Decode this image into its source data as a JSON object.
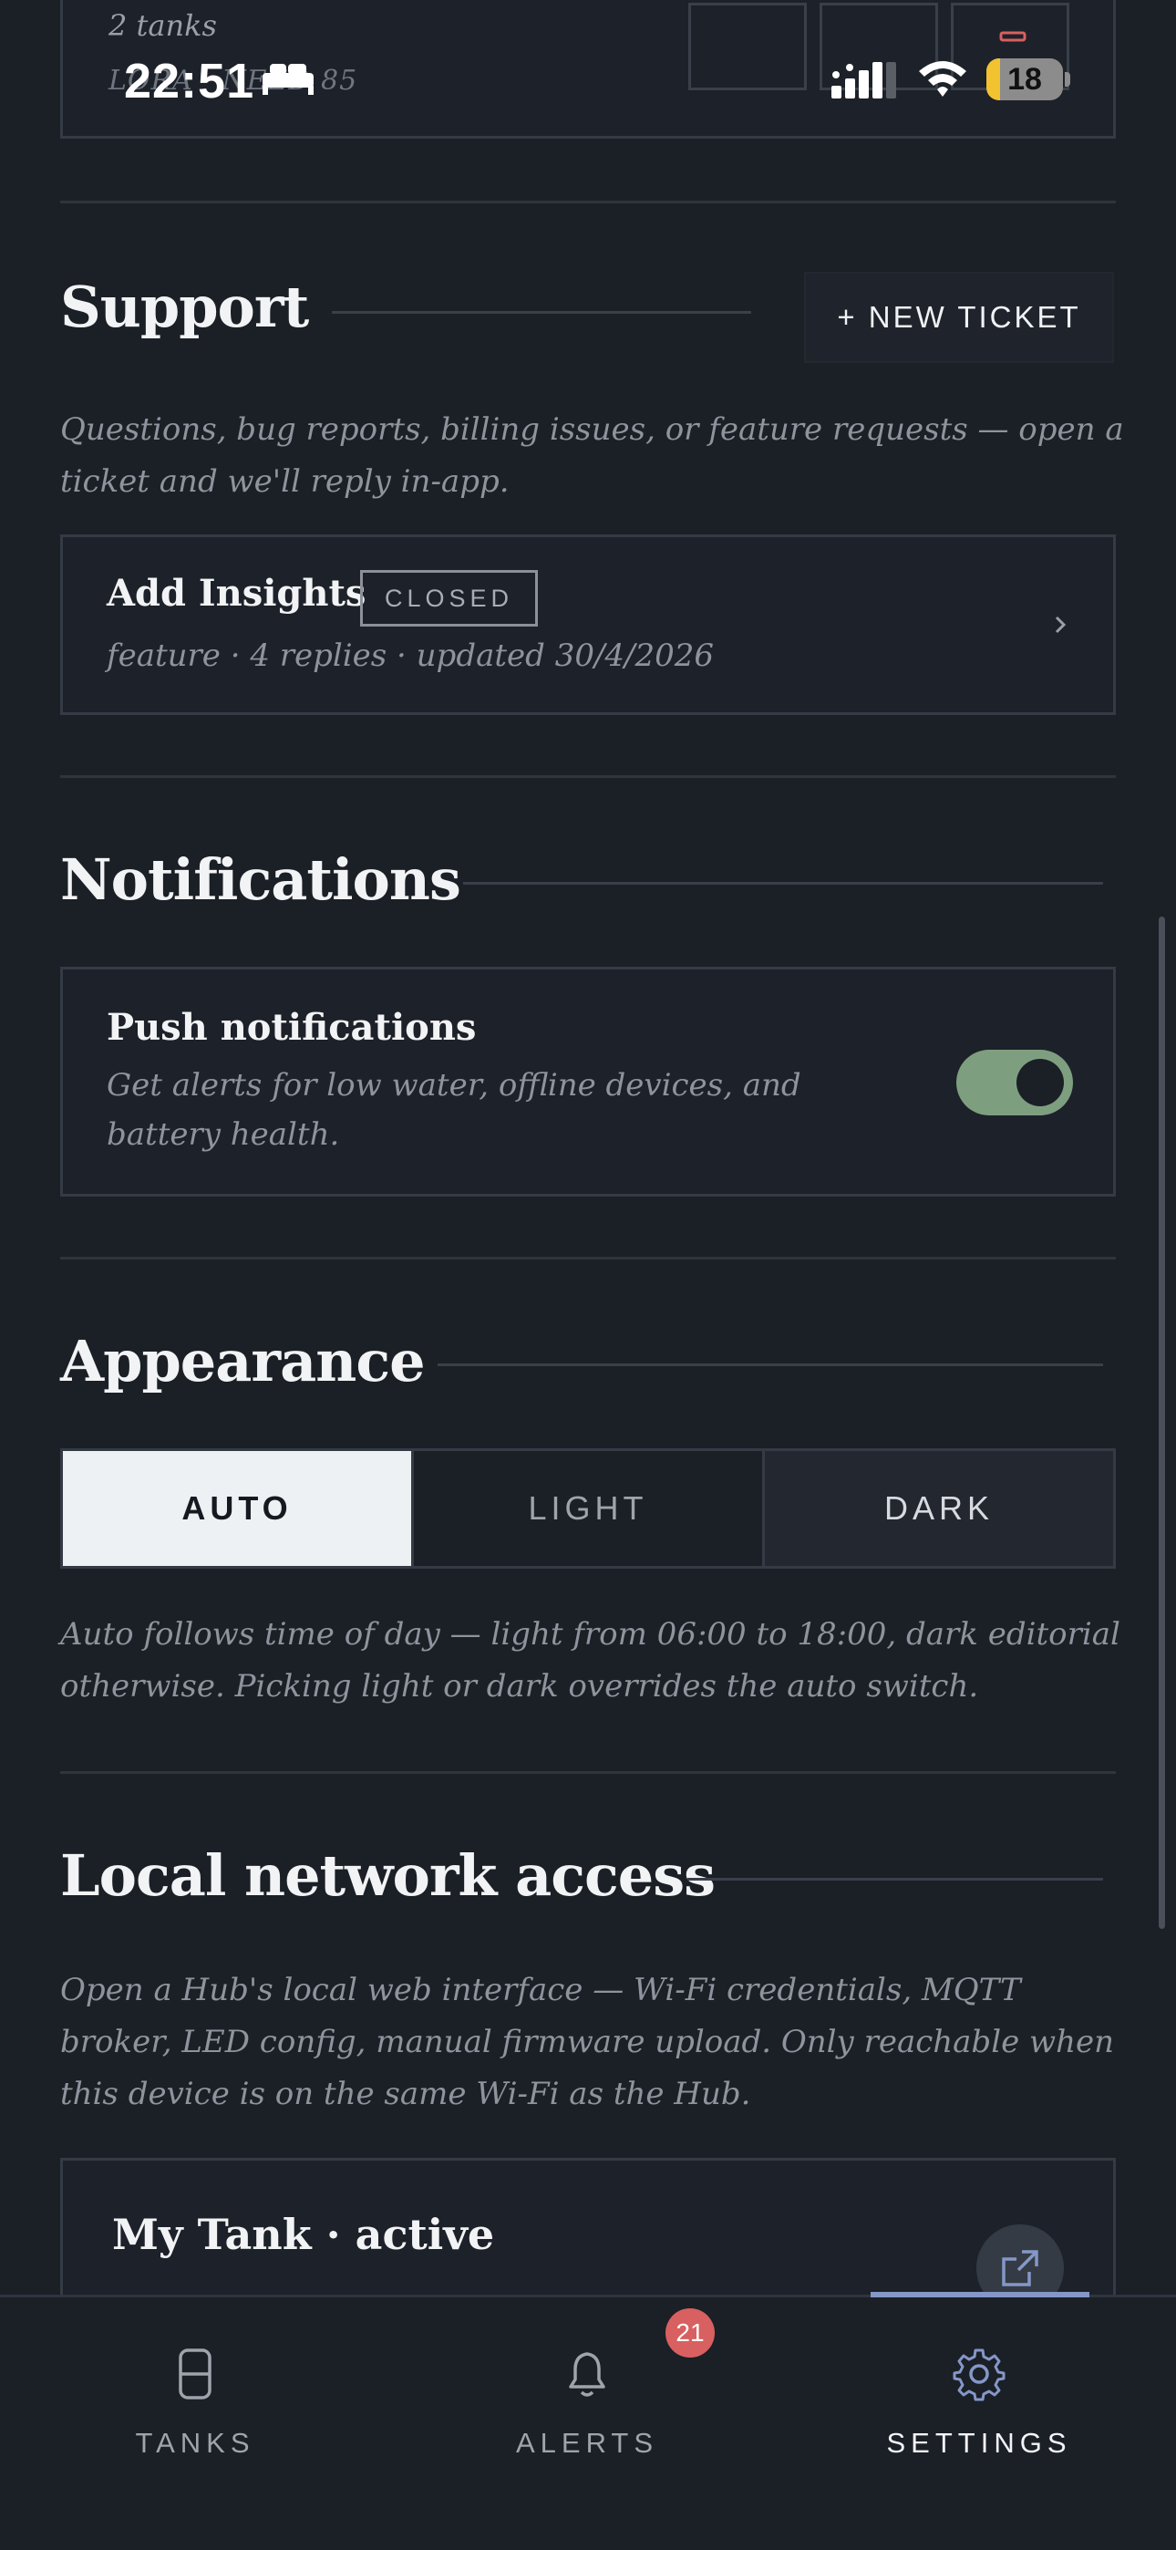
{
  "status_bar": {
    "time": "22:51",
    "battery_level": "18",
    "battery_fraction": 0.18
  },
  "tank_summary": {
    "count_text": "2 tanks",
    "leds_text": "LORA · NEED  85"
  },
  "support": {
    "title": "Support",
    "new_ticket_label": "+ NEW TICKET",
    "description": "Questions, bug reports, billing issues, or feature requests — open a ticket and we'll reply in-app.",
    "tickets": [
      {
        "title": "Add Insights",
        "status": "CLOSED",
        "meta": "feature · 4 replies · updated 30/4/2026"
      }
    ]
  },
  "notifications": {
    "title": "Notifications",
    "push_title": "Push notifications",
    "push_description": "Get alerts for low water, offline devices, and battery health.",
    "push_enabled": true
  },
  "appearance": {
    "title": "Appearance",
    "options": [
      "AUTO",
      "LIGHT",
      "DARK"
    ],
    "selected": "AUTO",
    "description": "Auto follows time of day — light from 06:00 to 18:00, dark editorial otherwise. Picking light or dark overrides the auto switch."
  },
  "local_network": {
    "title": "Local network access",
    "description": "Open a Hub's local web interface — Wi-Fi credentials, MQTT broker, LED config, manual firmware upload. Only reachable when this device is on the same Wi-Fi as the Hub.",
    "hubs": [
      {
        "name": "My Tank · active"
      }
    ]
  },
  "tabbar": {
    "tabs": [
      {
        "label": "TANKS",
        "icon": "tank-icon"
      },
      {
        "label": "ALERTS",
        "icon": "bell-icon",
        "badge": "21"
      },
      {
        "label": "SETTINGS",
        "icon": "gear-icon"
      }
    ],
    "active": "SETTINGS"
  },
  "colors": {
    "background": "#1b1f26",
    "toggle_on": "#7e9f7f",
    "alert_badge": "#d86060",
    "tab_indicator": "#8497c8",
    "battery_low": "#f2c230"
  }
}
